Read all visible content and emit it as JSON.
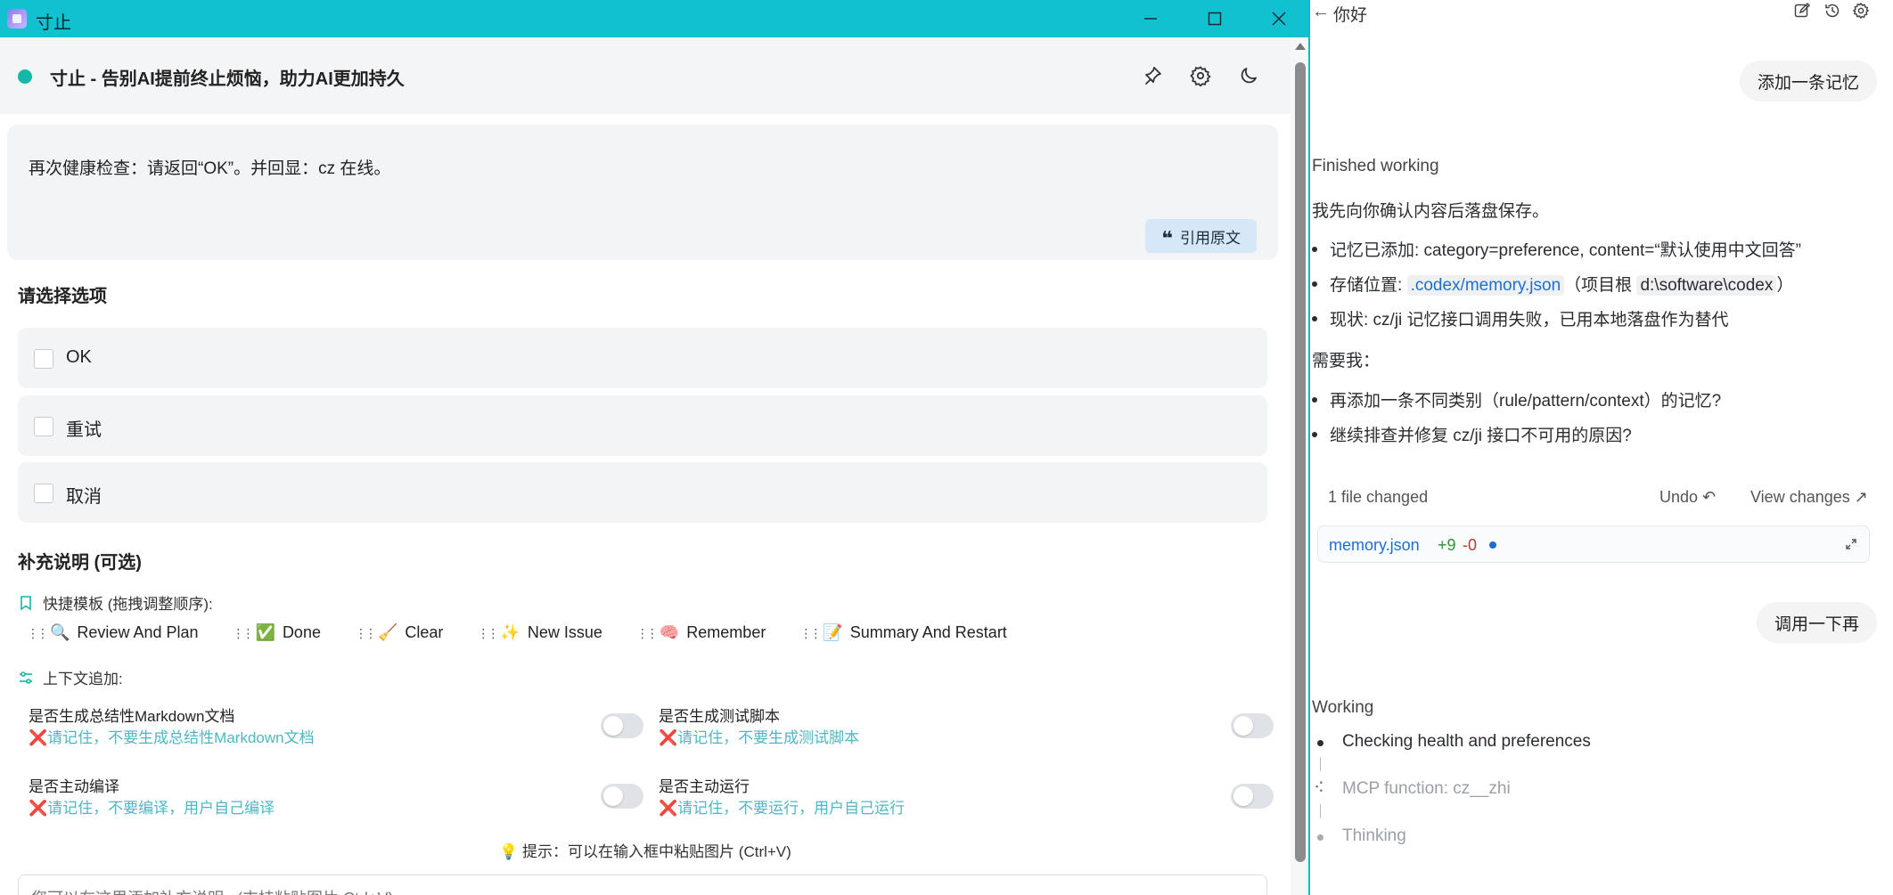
{
  "window": {
    "title": "寸止",
    "icons": {
      "minimize": "minimize-icon",
      "maximize": "maximize-icon",
      "close": "close-icon"
    }
  },
  "app_header": {
    "title": "寸止 - 告别AI提前终止烦恼，助力AI更加持久",
    "status_color": "#14b8a6",
    "icons": {
      "pin": "pin-icon",
      "settings": "gear-icon",
      "theme": "moon-icon"
    }
  },
  "message": {
    "text": "再次健康检查：请返回“OK”。并回显：cz 在线。",
    "quote_button": "引用原文"
  },
  "options": {
    "title": "请选择选项",
    "items": [
      {
        "label": "OK",
        "checked": false
      },
      {
        "label": "重试",
        "checked": false
      },
      {
        "label": "取消",
        "checked": false
      }
    ]
  },
  "supplement": {
    "title": "补充说明 (可选)",
    "quick_templates_label": "快捷模板 (拖拽调整顺序):",
    "templates": [
      {
        "emoji": "🔍",
        "label": "Review And Plan"
      },
      {
        "emoji": "✅",
        "label": "Done"
      },
      {
        "emoji": "🧹",
        "label": "Clear"
      },
      {
        "emoji": "✨",
        "label": "New Issue"
      },
      {
        "emoji": "🧠",
        "label": "Remember"
      },
      {
        "emoji": "📝",
        "label": "Summary And Restart"
      }
    ],
    "context_label": "上下文追加:",
    "toggles": [
      {
        "title": "是否生成总结性Markdown文档",
        "desc": "请记住，不要生成总结性Markdown文档",
        "on": false
      },
      {
        "title": "是否生成测试脚本",
        "desc": "请记住，不要生成测试脚本",
        "on": false
      },
      {
        "title": "是否主动编译",
        "desc": "请记住，不要编译，用户自己编译",
        "on": false
      },
      {
        "title": "是否主动运行",
        "desc": "请记住，不要运行，用户自己运行",
        "on": false
      }
    ],
    "tip": "💡 提示：可以在输入框中粘贴图片 (Ctrl+V)",
    "input_placeholder": "您可以在这里添加补充说明...(支持粘贴图片 Ctrl+V)"
  },
  "chat": {
    "title": "你好",
    "icons": {
      "back": "arrow-left-icon",
      "edit": "edit-icon",
      "history": "history-icon",
      "settings": "gear-icon"
    },
    "user_msg_1": "添加一条记忆",
    "status_1": "Finished working",
    "intro": "我先向你确认内容后落盘保存。",
    "bullets": {
      "b1": "记忆已添加: category=preference, content=“默认使用中文回答”",
      "b2_prefix": "存储位置: ",
      "b2_link": ".codex/memory.json",
      "b2_mid": "（项目根 ",
      "b2_code": "d:\\software\\codex",
      "b2_suffix": "）",
      "b3": "现状: cz/ji 记忆接口调用失败，已用本地落盘作为替代"
    },
    "need_me": "需要我：",
    "questions": [
      "再添加一条不同类别（rule/pattern/context）的记忆?",
      "继续排查并修复 cz/ji 接口不可用的原因?"
    ],
    "files_changed": "1 file changed",
    "undo": "Undo",
    "view_changes": "View changes",
    "file": {
      "name": "memory.json",
      "added": "+9",
      "removed": "-0"
    },
    "user_msg_2": "调用一下再",
    "status_2": "Working",
    "steps": [
      {
        "label": "Checking health and preferences",
        "state": "active"
      },
      {
        "label": "MCP function: cz__zhi",
        "state": "pending"
      },
      {
        "label": "Thinking",
        "state": "pending"
      }
    ]
  }
}
